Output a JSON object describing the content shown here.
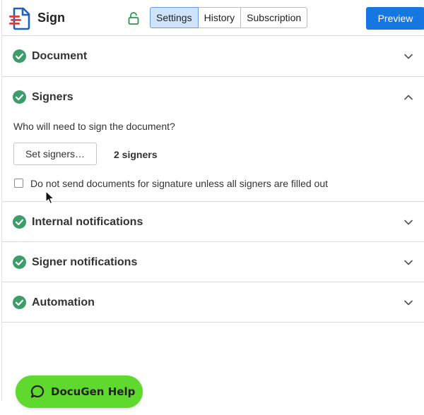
{
  "header": {
    "app_title": "Sign",
    "tabs": [
      {
        "label": "Settings",
        "active": true
      },
      {
        "label": "History",
        "active": false
      },
      {
        "label": "Subscription",
        "active": false
      }
    ],
    "preview_label": "Preview"
  },
  "sections": [
    {
      "title": "Document",
      "complete": true,
      "expanded": false
    },
    {
      "title": "Signers",
      "complete": true,
      "expanded": true,
      "question": "Who will need to sign the document?",
      "set_signers_label": "Set signers…",
      "signer_count": "2 signers",
      "checkbox_label": "Do not send documents for signature unless all signers are filled out",
      "checkbox_checked": false
    },
    {
      "title": "Internal notifications",
      "complete": true,
      "expanded": false
    },
    {
      "title": "Signer notifications",
      "complete": true,
      "expanded": false
    },
    {
      "title": "Automation",
      "complete": true,
      "expanded": false
    }
  ],
  "help": {
    "label": "DocuGen Help"
  },
  "colors": {
    "accent": "#1676e2",
    "check": "#3d9d6a",
    "help_bg": "#5fd92d",
    "active_tab": "#cfe3fb"
  }
}
